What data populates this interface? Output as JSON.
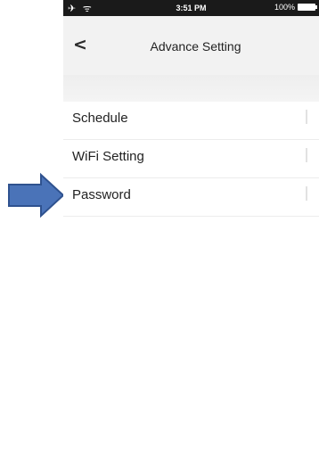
{
  "status_bar": {
    "left_icons": "✈ ᯤ",
    "time": "3:51 PM",
    "battery_text": "100%"
  },
  "nav": {
    "back_glyph": "<",
    "title": "Advance Setting"
  },
  "menu": {
    "items": [
      {
        "label": "Schedule"
      },
      {
        "label": "WiFi Setting"
      },
      {
        "label": "Password"
      }
    ]
  },
  "callout": {
    "arrow_color": "#4a73b8",
    "arrow_border": "#2f528f",
    "points_to": "Password"
  }
}
